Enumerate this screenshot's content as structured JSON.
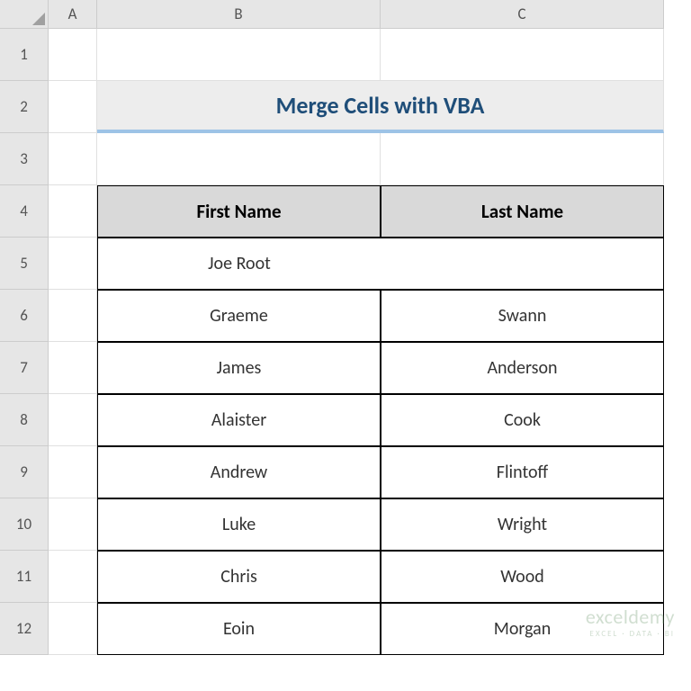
{
  "columns": [
    "A",
    "B",
    "C"
  ],
  "rows": [
    "1",
    "2",
    "3",
    "4",
    "5",
    "6",
    "7",
    "8",
    "9",
    "10",
    "11",
    "12"
  ],
  "title": "Merge Cells with VBA",
  "headers": {
    "first_name": "First Name",
    "last_name": "Last Name"
  },
  "chart_data": {
    "type": "table",
    "columns": [
      "First Name",
      "Last Name"
    ],
    "rows": [
      {
        "first_name": "Joe Root",
        "last_name": "",
        "merged": true
      },
      {
        "first_name": "Graeme",
        "last_name": "Swann"
      },
      {
        "first_name": "James",
        "last_name": "Anderson"
      },
      {
        "first_name": "Alaister",
        "last_name": "Cook"
      },
      {
        "first_name": "Andrew",
        "last_name": "Flintoff"
      },
      {
        "first_name": "Luke",
        "last_name": "Wright"
      },
      {
        "first_name": "Chris",
        "last_name": "Wood"
      },
      {
        "first_name": "Eoin",
        "last_name": "Morgan"
      }
    ]
  },
  "watermark": {
    "brand": "exceldemy",
    "tagline": "EXCEL · DATA · BI"
  }
}
